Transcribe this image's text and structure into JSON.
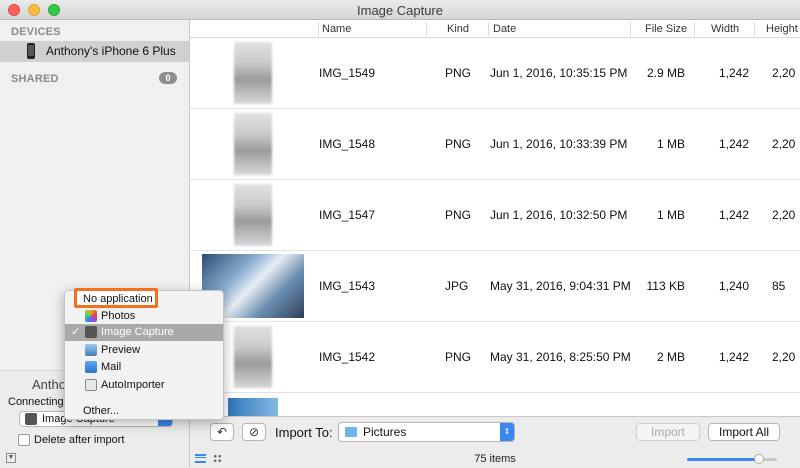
{
  "window": {
    "title": "Image Capture"
  },
  "sidebar": {
    "devices_label": "DEVICES",
    "device_name": "Anthony's iPhone 6 Plus",
    "shared_label": "SHARED",
    "shared_count": "0",
    "bottom": {
      "device_title_partial": "Anthon",
      "connecting_label": "Connecting t",
      "app_select_value": "Image Capture",
      "delete_after_import_label": "Delete after import"
    }
  },
  "columns": [
    "Name",
    "Kind",
    "Date",
    "File Size",
    "Width",
    "Height"
  ],
  "rows": [
    {
      "name": "IMG_1549",
      "kind": "PNG",
      "date": "Jun 1, 2016, 10:35:15 PM",
      "size": "2.9 MB",
      "width": "1,242",
      "height": "2,20"
    },
    {
      "name": "IMG_1548",
      "kind": "PNG",
      "date": "Jun 1, 2016, 10:33:39 PM",
      "size": "1 MB",
      "width": "1,242",
      "height": "2,20"
    },
    {
      "name": "IMG_1547",
      "kind": "PNG",
      "date": "Jun 1, 2016, 10:32:50 PM",
      "size": "1 MB",
      "width": "1,242",
      "height": "2,20"
    },
    {
      "name": "IMG_1543",
      "kind": "JPG",
      "date": "May 31, 2016, 9:04:31 PM",
      "size": "113 KB",
      "width": "1,240",
      "height": "85"
    },
    {
      "name": "IMG_1542",
      "kind": "PNG",
      "date": "May 31, 2016, 8:25:50 PM",
      "size": "2 MB",
      "width": "1,242",
      "height": "2,20"
    }
  ],
  "toolbar": {
    "import_to_label": "Import To:",
    "destination": "Pictures",
    "import_label": "Import",
    "import_all_label": "Import All",
    "item_count": "75 items",
    "thumbnail_size_fraction": 0.8
  },
  "menu": {
    "no_application": "No application",
    "items": [
      "Photos",
      "Image Capture",
      "Preview",
      "Mail",
      "AutoImporter"
    ],
    "selected": "Image Capture",
    "other": "Other..."
  },
  "colors": {
    "accent": "#3b87f0",
    "highlight": "#f37021"
  }
}
